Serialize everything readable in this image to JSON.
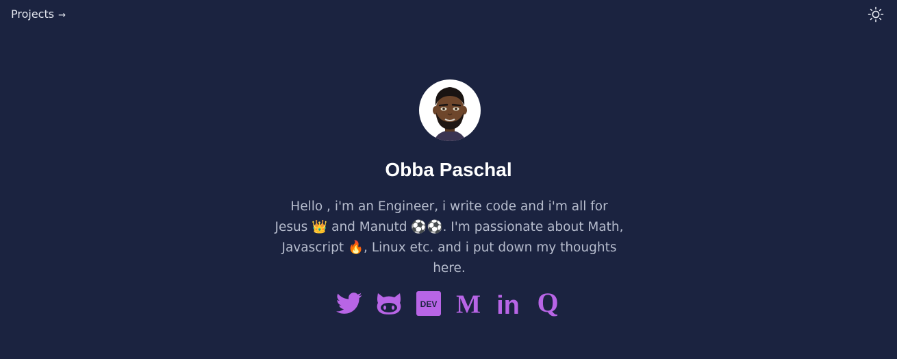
{
  "nav": {
    "projects_label": "Projects",
    "projects_arrow": "→"
  },
  "theme_toggle_icon": "sun-icon",
  "profile": {
    "name": "Obba Paschal",
    "bio": "Hello , i'm an Engineer, i write code and i'm all for Jesus 👑 and Manutd ⚽⚽. I'm passionate about Math, Javascript 🔥, Linux etc. and i put down my thoughts here.",
    "avatar_icon": "memoji-avatar"
  },
  "socials": [
    {
      "icon": "twitter-icon"
    },
    {
      "icon": "github-icon"
    },
    {
      "icon": "dev-icon",
      "text": "DEV"
    },
    {
      "icon": "medium-icon",
      "text": "M"
    },
    {
      "icon": "linkedin-icon",
      "text": "in"
    },
    {
      "icon": "quora-icon",
      "text": "Q"
    }
  ],
  "colors": {
    "background": "#1b2340",
    "accent": "#b865e6",
    "text": "#b6bccd",
    "heading": "#ffffff"
  }
}
